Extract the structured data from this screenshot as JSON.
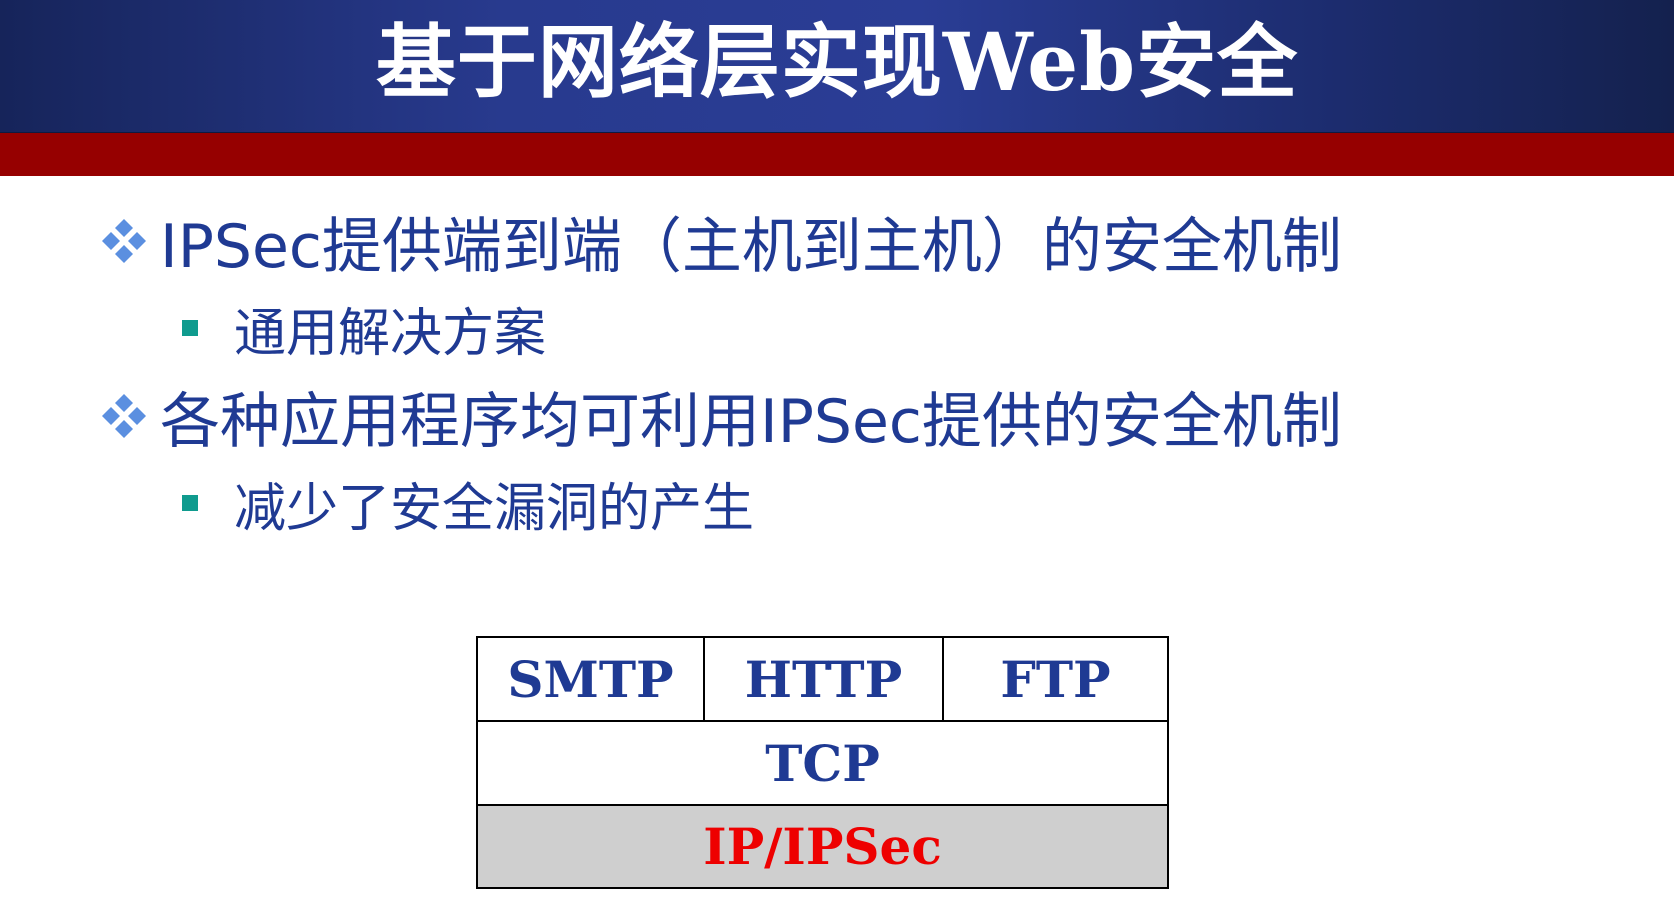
{
  "slide": {
    "title": "基于网络层实现Web安全"
  },
  "bullets": [
    {
      "text": "IPSec提供端到端（主机到主机）的安全机制",
      "sub": "通用解决方案"
    },
    {
      "text": "各种应用程序均可利用IPSec提供的安全机制",
      "sub": "减少了安全漏洞的产生"
    }
  ],
  "stack": {
    "top": [
      "SMTP",
      "HTTP",
      "FTP"
    ],
    "middle": "TCP",
    "bottom": "IP/IPSec"
  },
  "colors": {
    "title_bg": "#283a8e",
    "band": "#960000",
    "text": "#1f3a93",
    "bullet_square": "#0f9b8e",
    "diamond": "#5b8fe0",
    "ipsec": "#ee0000",
    "bottom_row_bg": "#cfcfcf"
  }
}
